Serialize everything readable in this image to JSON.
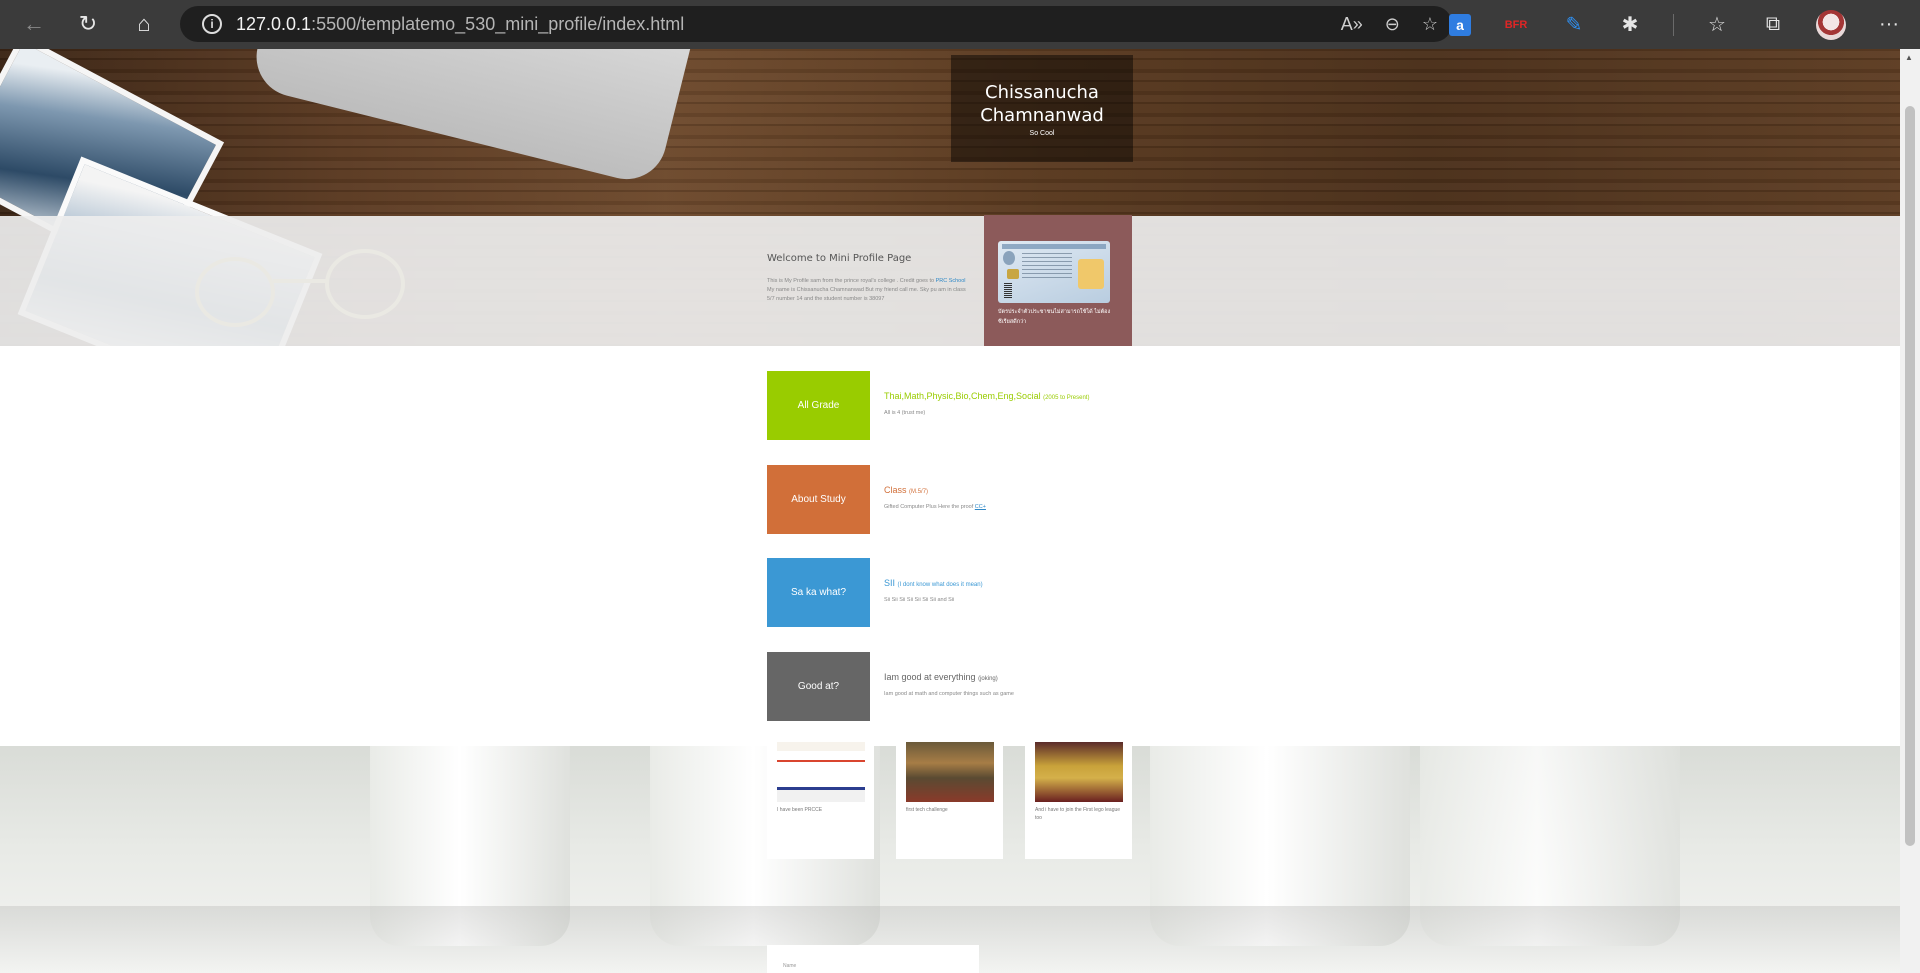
{
  "browser": {
    "url_host": "127.0.0.1",
    "url_path": ":5500/templatemo_530_mini_profile/index.html"
  },
  "hero": {
    "name": "Chissanucha Chamnanwad",
    "tagline": "So Cool"
  },
  "welcome": {
    "title": "Welcome to Mini Profile Page",
    "text_before": "This is My Profile sam from the prince royal's college . Credit goes to ",
    "link": "PRC School",
    "text_after": " My name is Chissanucha Chamnanwad But my friend call me. Sky pu am in class 5/7 number 14 and the student number is 38097",
    "card_caption": "บัตรประจำตัวประชาชนไม่สามารถใช้ได้ ไม่ต้องซีเรียสดีกว่า"
  },
  "rows": [
    {
      "tile": "All Grade",
      "color": "#99cc00",
      "title": "Thai,Math,Physic,Bio,Chem,Eng,Social",
      "title_small": "(2005 to Present)",
      "text": "All is 4 (trust me)",
      "link": ""
    },
    {
      "tile": "About Study",
      "color": "#d16f39",
      "title": "Class",
      "title_small": "(M.5/7)",
      "text": "Gifted Computer Plus Here the proof ",
      "link": "CC+"
    },
    {
      "tile": "Sa ka what?",
      "color": "#3b98d4",
      "title": "SII",
      "title_small": "(I dont know what does it mean)",
      "text": "Sii Sii Sii Sii Sii Sii Sii and Sii",
      "link": ""
    },
    {
      "tile": "Good at?",
      "color": "#666666",
      "title": "Iam good at everything",
      "title_small": "(joking)",
      "text": "Iam good at math and computer things such as game",
      "link": ""
    }
  ],
  "gallery": [
    {
      "caption": "I have been PRCCE"
    },
    {
      "caption": "first tech challenge"
    },
    {
      "caption": "And i have to join the First lego league too"
    }
  ],
  "form": {
    "name_label": "Name"
  }
}
